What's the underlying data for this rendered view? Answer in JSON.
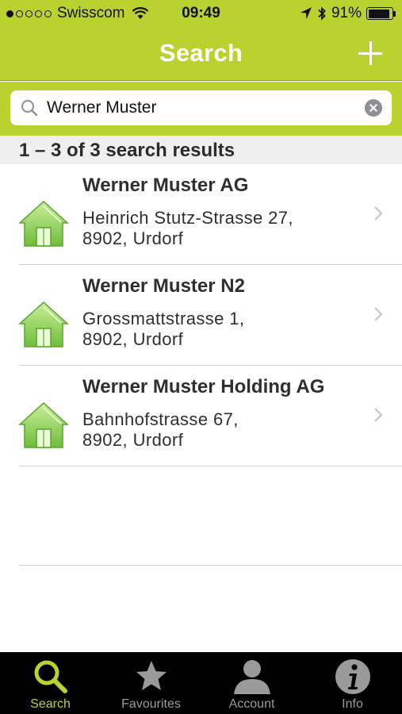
{
  "status_bar": {
    "carrier": "Swisscom",
    "time": "09:49",
    "battery": "91%",
    "battery_level": 0.91,
    "signal_bars_filled": 1,
    "signal_bars_total": 5
  },
  "nav": {
    "title": "Search",
    "add_icon": "plus-icon"
  },
  "search": {
    "value": "Werner Muster",
    "placeholder": "",
    "icon": "search-icon",
    "clear_icon": "clear-icon"
  },
  "results": {
    "count_text": "1 – 3 of 3 search results",
    "items": [
      {
        "name": "Werner Muster AG",
        "address_line1": "Heinrich Stutz-Strasse 27,",
        "address_line2": "8902, Urdorf",
        "icon": "house-icon"
      },
      {
        "name": "Werner Muster N2",
        "address_line1": "Grossmattstrasse 1,",
        "address_line2": "8902, Urdorf",
        "icon": "house-icon"
      },
      {
        "name": "Werner Muster Holding AG",
        "address_line1": "Bahnhofstrasse 67,",
        "address_line2": "8902, Urdorf",
        "icon": "house-icon"
      }
    ]
  },
  "tabbar": {
    "tabs": [
      {
        "label": "Search",
        "icon": "search-icon",
        "active": true
      },
      {
        "label": "Favourites",
        "icon": "star-icon",
        "active": false
      },
      {
        "label": "Account",
        "icon": "person-icon",
        "active": false
      },
      {
        "label": "Info",
        "icon": "info-icon",
        "active": false
      }
    ]
  },
  "colors": {
    "accent": "#b9d22f",
    "house_green": "#7fc64a",
    "tabbar_bg": "#000000",
    "tab_inactive": "#9a9a9a"
  }
}
